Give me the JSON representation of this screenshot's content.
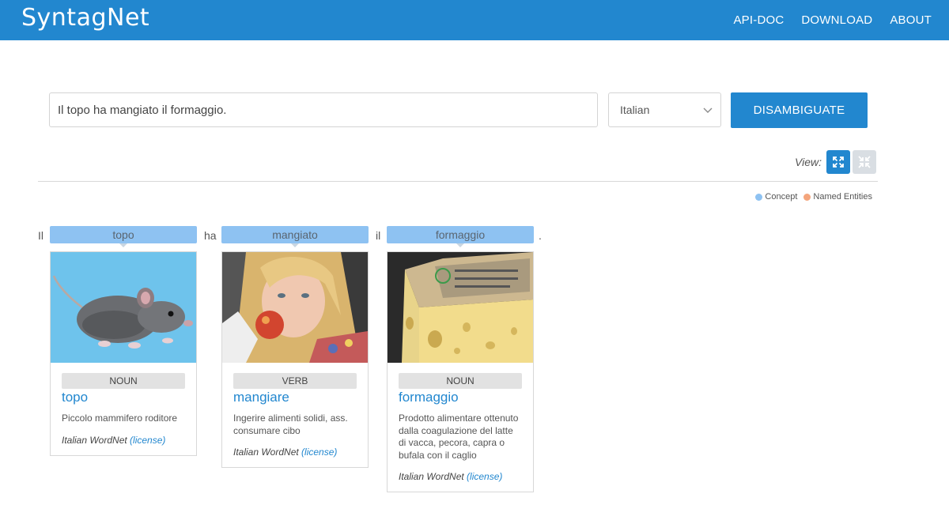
{
  "header": {
    "brand": "SyntagNet",
    "nav": [
      "API-DOC",
      "DOWNLOAD",
      "ABOUT"
    ]
  },
  "search": {
    "value": "Il topo ha mangiato il formaggio.",
    "language": "Italian",
    "button": "DISAMBIGUATE"
  },
  "view": {
    "label": "View:"
  },
  "legend": {
    "concept": "Concept",
    "named_entities": "Named Entities",
    "concept_color": "#8ec2f2",
    "ne_color": "#f4a57c"
  },
  "tokens": [
    "Il",
    "topo",
    "ha",
    "mangiato",
    "il",
    "formaggio",
    "."
  ],
  "cards": [
    {
      "token": "topo",
      "pos": "NOUN",
      "lemma": "topo",
      "gloss": "Piccolo mammifero roditore",
      "source": "Italian WordNet",
      "license": "(license)",
      "image": "mouse-image"
    },
    {
      "token": "mangiato",
      "pos": "VERB",
      "lemma": "mangiare",
      "gloss": "Ingerire alimenti solidi, ass. consumare cibo",
      "source": "Italian WordNet",
      "license": "(license)",
      "image": "girl-eating-apple-image"
    },
    {
      "token": "formaggio",
      "pos": "NOUN",
      "lemma": "formaggio",
      "gloss": "Prodotto alimentare ottenuto dalla coagulazione del latte di vacca, pecora, capra o bufala con il caglio",
      "source": "Italian WordNet",
      "license": "(license)",
      "image": "cheese-image"
    }
  ]
}
